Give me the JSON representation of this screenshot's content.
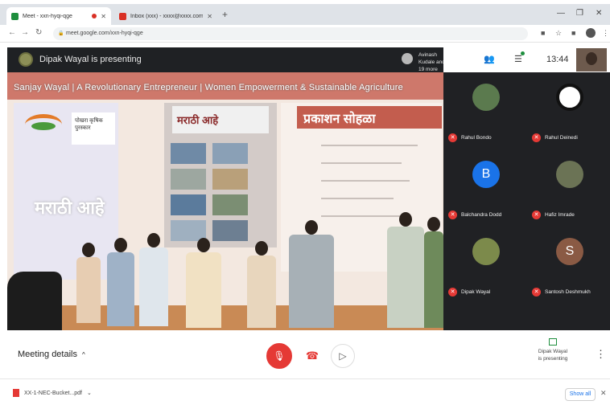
{
  "browser": {
    "tabs": [
      {
        "title": "Meet - xxn-hyqi-qge",
        "active": true
      },
      {
        "title": "Inbox (xxx) - xxxx@xxxx.com",
        "active": false
      }
    ],
    "url": "meet.google.com/xxn-hyqi-qge"
  },
  "meet": {
    "presenting_label": "Dipak Wayal is presenting",
    "others_label": "Avinash Kudale and 19 more",
    "time": "13:44",
    "presentation_title": "Sanjay Wayal | A Revolutionary Entrepreneur | Women Empowerment & Sustainable Agriculture",
    "left_card_text": "पोखरा कृषिक पुरस्कार",
    "left_marathi": "मराठी आहे",
    "grid_header": "मराठी आहे",
    "right_banner_header": "प्रकाशन सोहळा"
  },
  "participants": [
    {
      "name": "Rahul Bondo",
      "avatar": "photo",
      "color": "#5b7a4e"
    },
    {
      "name": "Rahul Deinedi",
      "avatar": "logo",
      "color": "#ffffff"
    },
    {
      "name": "Balchandra Dodd",
      "avatar": "letter",
      "letter": "B",
      "color": "#1a73e8"
    },
    {
      "name": "Hafiz Imrade",
      "avatar": "photo",
      "color": "#6b7355"
    },
    {
      "name": "Dipak Wayal",
      "avatar": "photo",
      "color": "#7c8a4b"
    },
    {
      "name": "Santosh Deshmukh",
      "avatar": "letter",
      "letter": "S",
      "color": "#8a5a44"
    }
  ],
  "controls": {
    "meeting_details": "Meeting details",
    "presenting_name": "Dipak Wayal",
    "presenting_sub": "is presenting"
  },
  "shelf": {
    "file": "XX-1-NEC-Bucket...pdf",
    "show_all": "Show all"
  },
  "colors": {
    "accent": "#1a73e8",
    "mute_red": "#e53935",
    "present_green": "#1e8e3e",
    "panel_dark": "#202124"
  }
}
